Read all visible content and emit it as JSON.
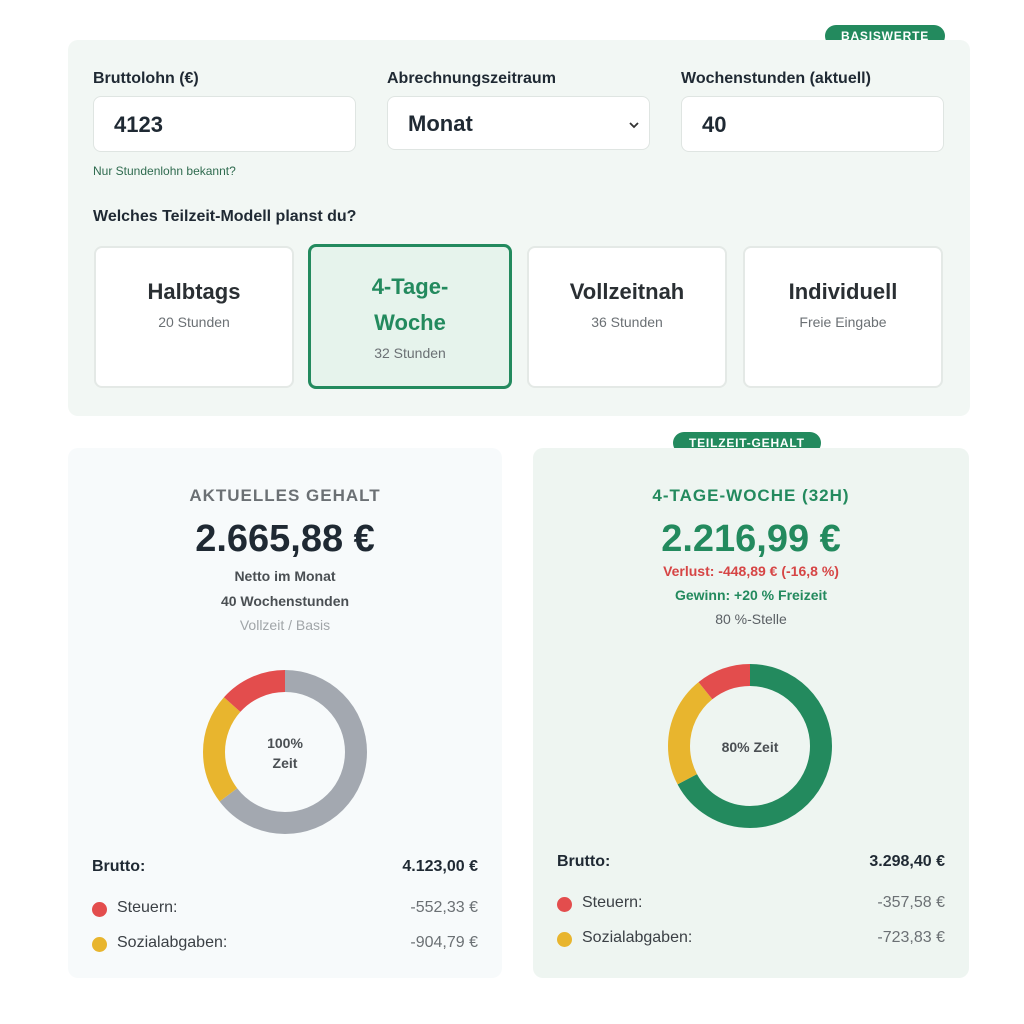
{
  "badges": {
    "top": "BASISWERTE",
    "part": "TEILZEIT-GEHALT"
  },
  "inputs": {
    "gross": {
      "label": "Bruttolohn (€)",
      "value": "4123",
      "hint": "Nur Stundenlohn bekannt?"
    },
    "period": {
      "label": "Abrechnungszeitraum",
      "value": "Monat"
    },
    "hours": {
      "label": "Wochenstunden (aktuell)",
      "value": "40"
    }
  },
  "question": "Welches Teilzeit-Modell planst du?",
  "models": [
    {
      "title": "Halbtags",
      "sub": "20 Stunden"
    },
    {
      "title": "4-Tage-Woche",
      "sub": "32 Stunden"
    },
    {
      "title": "Vollzeitnah",
      "sub": "36 Stunden"
    },
    {
      "title": "Individuell",
      "sub": "Freie Eingabe"
    }
  ],
  "current": {
    "heading": "AKTUELLES GEHALT",
    "amount": "2.665,88 €",
    "net_label": "Netto im Monat",
    "hours_label": "40 Wochenstunden",
    "basis_label": "Vollzeit / Basis",
    "donut_label_1": "100%",
    "donut_label_2": "Zeit",
    "donut": {
      "taxes": 552.33,
      "social": 904.79,
      "net": 2665.88
    },
    "gross_label": "Brutto:",
    "gross_value": "4.123,00 €",
    "tax_label": "Steuern:",
    "tax_value": "-552,33 €",
    "social_label": "Sozialabgaben:",
    "social_value": "-904,79 €"
  },
  "parttime": {
    "heading": "4-TAGE-WOCHE (32H)",
    "amount": "2.216,99 €",
    "loss": "Verlust: -448,89 € (-16,8 %)",
    "gain": "Gewinn: +20 % Freizeit",
    "position": "80 %-Stelle",
    "donut_label": "80% Zeit",
    "donut": {
      "taxes": 357.58,
      "social": 723.83,
      "net": 2216.99
    },
    "gross_label": "Brutto:",
    "gross_value": "3.298,40 €",
    "tax_label": "Steuern:",
    "tax_value": "-357,58 €",
    "social_label": "Sozialabgaben:",
    "social_value": "-723,83 €"
  },
  "colors": {
    "accent": "#238a5e",
    "taxes": "#e34d4d",
    "social": "#e8b52e",
    "net_current": "#a3a8b0",
    "net_parttime": "#238a5e"
  }
}
